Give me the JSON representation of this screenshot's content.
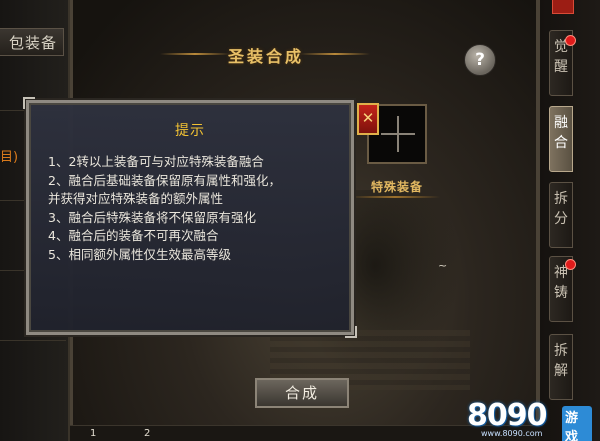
{
  "left_panel": {
    "bag_tab_label": "包装备",
    "orange_text": "目)"
  },
  "main": {
    "title": "圣装合成",
    "help_label": "?",
    "special_slot_label": "特殊装备",
    "fuse_button_label": "合成",
    "tilde": "~"
  },
  "dialog": {
    "title": "提示",
    "close_label": "✕",
    "lines": [
      "1、2转以上装备可与对应特殊装备融合",
      "2、融合后基础装备保留原有属性和强化，",
      "并获得对应特殊装备的额外属性",
      "3、融合后特殊装备将不保留原有强化",
      "4、融合后的装备不可再次融合",
      "5、相同额外属性仅生效最高等级"
    ]
  },
  "right_tabs": [
    {
      "label": "觉醒",
      "active": false,
      "badge": true
    },
    {
      "label": "融合",
      "active": true,
      "badge": false
    },
    {
      "label": "拆分",
      "active": false,
      "badge": false
    },
    {
      "label": "神铸",
      "active": false,
      "badge": true
    },
    {
      "label": "拆解",
      "active": false,
      "badge": false
    }
  ],
  "bottom": {
    "slot1": "1",
    "slot2": "2"
  },
  "watermark": {
    "text": "8090",
    "badge": "游戏",
    "url": "www.8090.com"
  },
  "colors": {
    "title_gold": "#e8c067",
    "dialog_title": "#f2c233",
    "badge_red": "#e01b1b"
  }
}
